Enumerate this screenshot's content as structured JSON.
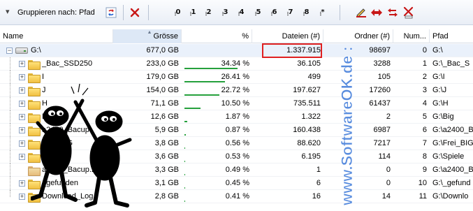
{
  "toolbar": {
    "group_label": "Gruppieren nach: Pfad",
    "level_buttons": [
      "0",
      "1",
      "2",
      "3",
      "4",
      "5",
      "6",
      "7",
      "8",
      "*"
    ]
  },
  "columns": {
    "name": "Name",
    "size": "Grösse",
    "percent": "%",
    "files": "Dateien (#)",
    "folders": "Ordner (#)",
    "number": "Num...",
    "path": "Pfad"
  },
  "rows": [
    {
      "name": "G:\\",
      "size": "677,0 GB",
      "percent": "",
      "files": "1.337.915",
      "folders": "98697",
      "number": "0",
      "path": "G:\\",
      "pct_value": 0
    },
    {
      "name": "_Bac_SSD250",
      "size": "233,0 GB",
      "percent": "34.34 %",
      "files": "36.105",
      "folders": "3288",
      "number": "1",
      "path": "G:\\_Bac_S",
      "pct_value": 34.34
    },
    {
      "name": "I",
      "size": "179,0 GB",
      "percent": "26.41 %",
      "files": "499",
      "folders": "105",
      "number": "2",
      "path": "G:\\I",
      "pct_value": 26.41
    },
    {
      "name": "J",
      "size": "154,0 GB",
      "percent": "22.72 %",
      "files": "197.627",
      "folders": "17260",
      "number": "3",
      "path": "G:\\J",
      "pct_value": 22.72
    },
    {
      "name": "H",
      "size": "71,1 GB",
      "percent": "10.50 %",
      "files": "735.511",
      "folders": "61437",
      "number": "4",
      "path": "G:\\H",
      "pct_value": 10.5
    },
    {
      "name": "Big",
      "size": "12,6 GB",
      "percent": "1.87 %",
      "files": "1.322",
      "folders": "2",
      "number": "5",
      "path": "G:\\Big",
      "pct_value": 1.87
    },
    {
      "name": "a2400_Bacup",
      "size": "5,9 GB",
      "percent": "0.87 %",
      "files": "160.438",
      "folders": "6987",
      "number": "6",
      "path": "G:\\a2400_B",
      "pct_value": 0.87
    },
    {
      "name": "Frei_BIG",
      "size": "3,8 GB",
      "percent": "0.56 %",
      "files": "88.620",
      "folders": "7217",
      "number": "7",
      "path": "G:\\Frei_BIG",
      "pct_value": 0.56
    },
    {
      "name": "Spiele",
      "size": "3,6 GB",
      "percent": "0.53 %",
      "files": "6.195",
      "folders": "114",
      "number": "8",
      "path": "G:\\Spiele",
      "pct_value": 0.53
    },
    {
      "name": "a2400_Bacup.zip",
      "size": "3,3 GB",
      "percent": "0.49 %",
      "files": "1",
      "folders": "0",
      "number": "9",
      "path": "G:\\a2400_B",
      "pct_value": 0.49
    },
    {
      "name": "_gefunden",
      "size": "3,1 GB",
      "percent": "0.45 %",
      "files": "6",
      "folders": "0",
      "number": "10",
      "path": "G:\\_gefund",
      "pct_value": 0.45
    },
    {
      "name": "Download_Log",
      "size": "2,8 GB",
      "percent": "0.41 %",
      "files": "16",
      "folders": "14",
      "number": "11",
      "path": "G:\\Downlo",
      "pct_value": 0.41
    }
  ],
  "watermark": "www.SoftwareOK.de :-)",
  "colors": {
    "percent_bar": "#25a03c",
    "highlight_box": "#e02020",
    "watermark": "#3b78d8"
  }
}
